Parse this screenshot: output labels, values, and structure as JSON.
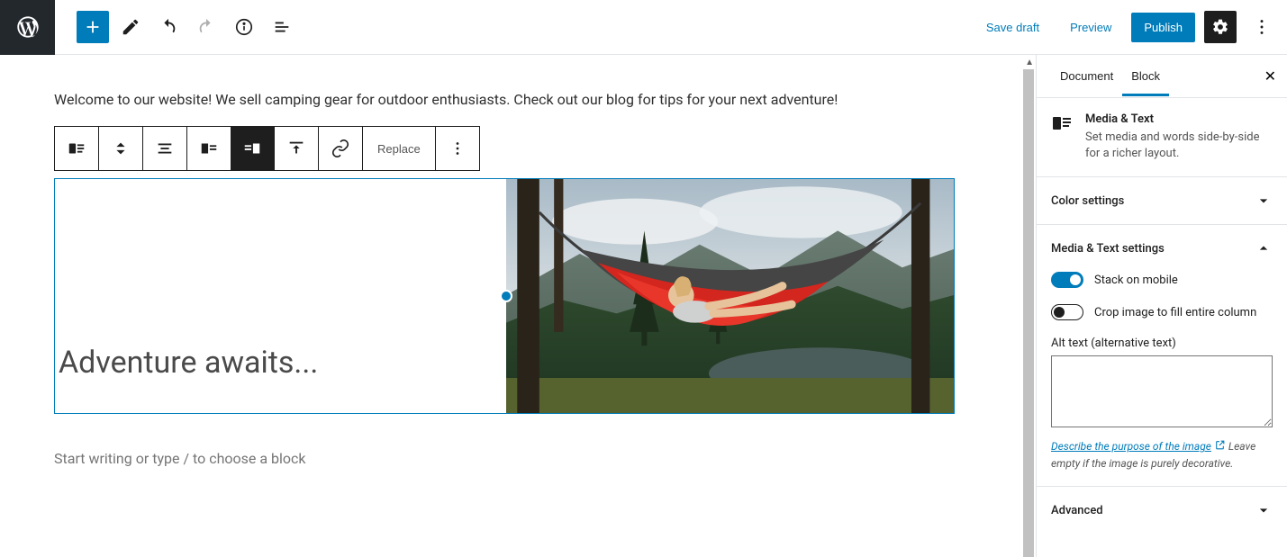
{
  "topbar": {
    "save_draft": "Save draft",
    "preview": "Preview",
    "publish": "Publish"
  },
  "toolbar": {
    "replace_label": "Replace"
  },
  "editor": {
    "intro_text": "Welcome to our website! We sell camping gear for outdoor enthusiasts. Check out our blog for tips for your next adventure!",
    "headline": "Adventure awaits...",
    "placeholder": "Start writing or type / to choose a block"
  },
  "sidebar": {
    "tabs": {
      "document": "Document",
      "block": "Block"
    },
    "block_info": {
      "title": "Media & Text",
      "desc": "Set media and words side-by-side for a richer layout."
    },
    "panels": {
      "color": "Color settings",
      "media_text": "Media & Text settings",
      "advanced": "Advanced"
    },
    "settings": {
      "stack_on_mobile": "Stack on mobile",
      "crop_fill": "Crop image to fill entire column",
      "alt_label": "Alt text (alternative text)",
      "alt_link": "Describe the purpose of the image",
      "alt_help_tail": "Leave empty if the image is purely decorative."
    }
  }
}
